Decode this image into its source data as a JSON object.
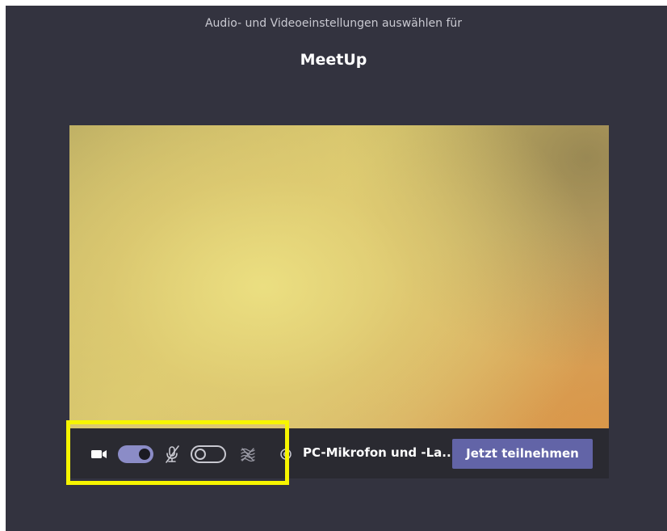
{
  "header": {
    "subtitle": "Audio- und Videoeinstellungen auswählen für",
    "meeting_title": "MeetUp"
  },
  "controls": {
    "camera_icon": "video-camera-icon",
    "camera_toggle_state": "on",
    "microphone_icon": "microphone-off-icon",
    "microphone_toggle_state": "off",
    "background_blur_icon": "background-blur-icon",
    "settings_icon": "gear-icon",
    "device_label": "PC-Mikrofon und -La...",
    "join_button_label": "Jetzt teilnehmen"
  },
  "colors": {
    "background": "#33333f",
    "toolbar": "#2a2a31",
    "accent": "#6264a7",
    "toggle_on": "#8b8cc7",
    "highlight": "#f7f500"
  }
}
